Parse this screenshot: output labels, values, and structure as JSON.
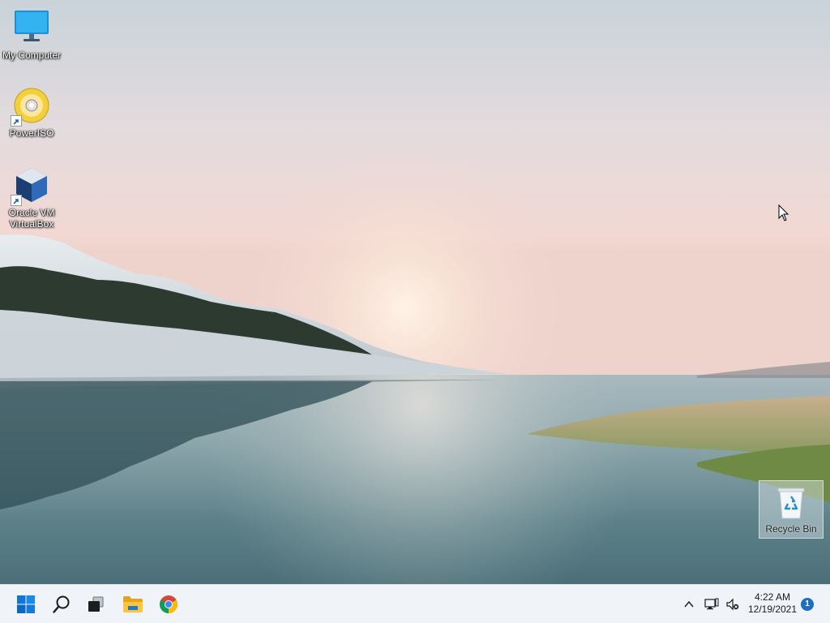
{
  "desktop": {
    "icons": [
      {
        "label": "My Computer",
        "icon": "monitor-icon",
        "shortcut": false
      },
      {
        "label": "PowerISO",
        "icon": "disc-icon",
        "shortcut": true
      },
      {
        "label": "Oracle VM\nVirtualBox",
        "icon": "virtualbox-cube-icon",
        "shortcut": true
      }
    ],
    "recycle_bin": {
      "label": "Recycle Bin",
      "icon": "recycle-bin-icon",
      "selected": true
    }
  },
  "taskbar": {
    "buttons": [
      {
        "name": "start",
        "icon": "windows-logo-icon"
      },
      {
        "name": "search",
        "icon": "search-icon"
      },
      {
        "name": "task-view",
        "icon": "task-view-icon"
      },
      {
        "name": "file-explorer",
        "icon": "folder-icon"
      },
      {
        "name": "chrome",
        "icon": "chrome-icon"
      }
    ],
    "tray": {
      "overflow_icon": "chevron-up-icon",
      "network_icon": "network-icon",
      "volume_icon": "volume-muted-icon",
      "time": "4:22 AM",
      "date": "12/19/2021",
      "notification_count": "1"
    }
  },
  "colors": {
    "accent": "#0078d4",
    "taskbar_bg": "#f0f3f7"
  }
}
